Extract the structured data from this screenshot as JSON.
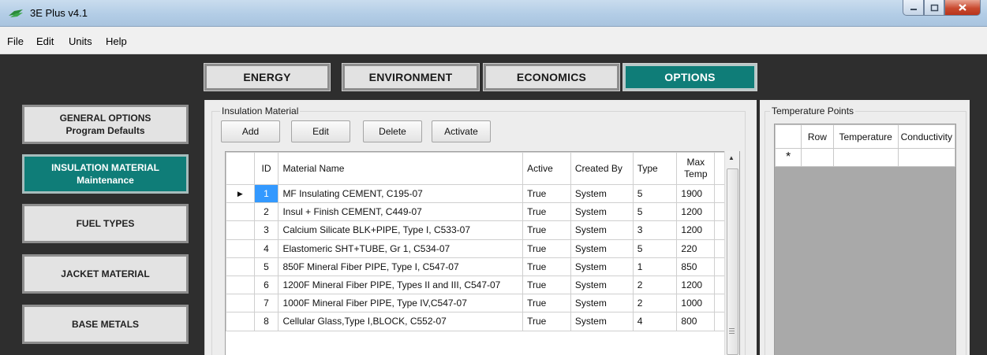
{
  "window": {
    "title": "3E Plus v4.1"
  },
  "menu": [
    "File",
    "Edit",
    "Units",
    "Help"
  ],
  "nav_tabs": [
    {
      "label": "ENERGY",
      "active": false
    },
    {
      "label": "ENVIRONMENT",
      "active": false
    },
    {
      "label": "ECONOMICS",
      "active": false
    },
    {
      "label": "OPTIONS",
      "active": true
    }
  ],
  "sidebar": [
    {
      "line1": "GENERAL OPTIONS",
      "line2": "Program Defaults",
      "active": false
    },
    {
      "line1": "INSULATION MATERIAL",
      "line2": "Maintenance",
      "active": true
    },
    {
      "line1": "FUEL TYPES",
      "line2": "",
      "active": false
    },
    {
      "line1": "JACKET MATERIAL",
      "line2": "",
      "active": false
    },
    {
      "line1": "BASE METALS",
      "line2": "",
      "active": false
    }
  ],
  "insulation": {
    "group_label": "Insulation Material",
    "buttons": [
      "Add",
      "Edit",
      "Delete",
      "Activate"
    ],
    "columns": {
      "id": "ID",
      "name": "Material Name",
      "active": "Active",
      "created_by": "Created By",
      "type": "Type",
      "max_temp": "Max\nTemp"
    },
    "rows": [
      {
        "id": "1",
        "name": "MF Insulating CEMENT, C195-07",
        "active": "True",
        "created_by": "System",
        "type": "5",
        "max_temp": "1900",
        "selected": true
      },
      {
        "id": "2",
        "name": "Insul + Finish CEMENT, C449-07",
        "active": "True",
        "created_by": "System",
        "type": "5",
        "max_temp": "1200"
      },
      {
        "id": "3",
        "name": "Calcium Silicate BLK+PIPE, Type I, C533-07",
        "active": "True",
        "created_by": "System",
        "type": "3",
        "max_temp": "1200"
      },
      {
        "id": "4",
        "name": "Elastomeric SHT+TUBE, Gr 1, C534-07",
        "active": "True",
        "created_by": "System",
        "type": "5",
        "max_temp": "220"
      },
      {
        "id": "5",
        "name": "850F Mineral Fiber PIPE, Type I, C547-07",
        "active": "True",
        "created_by": "System",
        "type": "1",
        "max_temp": "850"
      },
      {
        "id": "6",
        "name": "1200F Mineral Fiber PIPE, Types II and III, C547-07",
        "active": "True",
        "created_by": "System",
        "type": "2",
        "max_temp": "1200"
      },
      {
        "id": "7",
        "name": "1000F Mineral Fiber PIPE, Type IV,C547-07",
        "active": "True",
        "created_by": "System",
        "type": "2",
        "max_temp": "1000"
      },
      {
        "id": "8",
        "name": "Cellular Glass,Type I,BLOCK, C552-07",
        "active": "True",
        "created_by": "System",
        "type": "4",
        "max_temp": "800"
      }
    ]
  },
  "temperature": {
    "group_label": "Temperature Points",
    "columns": [
      "Row",
      "Temperature",
      "Conductivity"
    ],
    "new_row_marker": "*"
  },
  "icons": {
    "row_pointer": "triangle-right",
    "new_row": "asterisk",
    "scroll_up": "triangle-up"
  }
}
